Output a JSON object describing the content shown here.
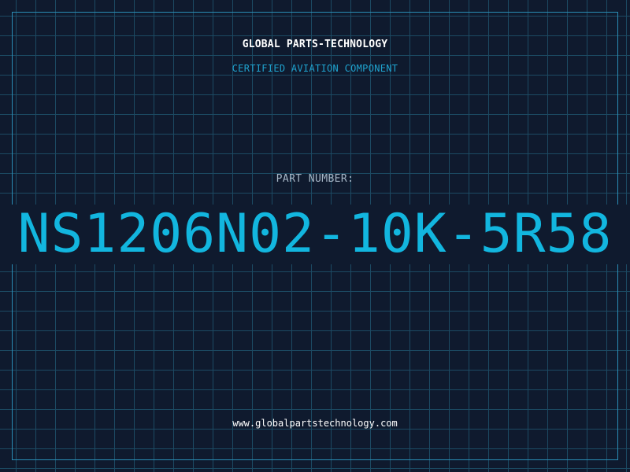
{
  "header": {
    "company": "GLOBAL PARTS-TECHNOLOGY",
    "tagline": "CERTIFIED AVIATION COMPONENT"
  },
  "part": {
    "label": "PART NUMBER:",
    "number": "NS1206N02-10K-5R58"
  },
  "footer": {
    "website": "www.globalpartstechnology.com"
  },
  "colors": {
    "background": "#0f1a2e",
    "grid": "#1c4a63",
    "accent": "#12b6df",
    "text": "#ffffff",
    "muted": "#a8b8c8"
  }
}
